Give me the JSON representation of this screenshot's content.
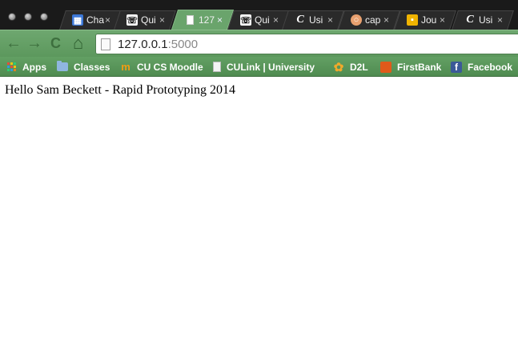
{
  "browser": {
    "tabs": [
      {
        "title": "Cha",
        "favicon": "calendar-icon",
        "fav_color": "#3c78d8",
        "active": false
      },
      {
        "title": "Qui",
        "favicon": "phone-logo-icon",
        "fav_color": "#ffffff",
        "active": false
      },
      {
        "title": "127",
        "favicon": "page-icon",
        "fav_color": "#ffffff",
        "active": true
      },
      {
        "title": "Qui",
        "favicon": "phone-logo-icon",
        "fav_color": "#ffffff",
        "active": false
      },
      {
        "title": "Usi",
        "favicon": "c-logo-icon",
        "fav_color": "#ffffff",
        "active": false
      },
      {
        "title": "cap",
        "favicon": "capture-icon",
        "fav_color": "#e8a06f",
        "active": false
      },
      {
        "title": "Jou",
        "favicon": "journal-icon",
        "fav_color": "#f0b400",
        "active": false
      },
      {
        "title": "Usi",
        "favicon": "c-logo-icon",
        "fav_color": "#ffffff",
        "active": false
      }
    ],
    "tab_close_glyph": "×",
    "toolbar": {
      "back_glyph": "←",
      "forward_glyph": "→",
      "reload_glyph": "C",
      "home_glyph": "⌂",
      "url_host": "127.0.0.1",
      "url_port": ":5000"
    },
    "bookmarks": [
      {
        "label": "Apps",
        "icon": "apps-grid-icon"
      },
      {
        "label": "Classes",
        "icon": "folder-icon"
      },
      {
        "label": "CU CS Moodle",
        "icon": "moodle-icon"
      },
      {
        "label": "CULink | University o",
        "icon": "document-icon"
      },
      {
        "label": "D2L",
        "icon": "d2l-icon"
      },
      {
        "label": "FirstBank",
        "icon": "firstbank-icon"
      },
      {
        "label": "Facebook",
        "icon": "facebook-icon"
      }
    ],
    "accent_color": "#5c985d"
  },
  "page": {
    "text": "Hello Sam Beckett - Rapid Prototyping 2014"
  }
}
